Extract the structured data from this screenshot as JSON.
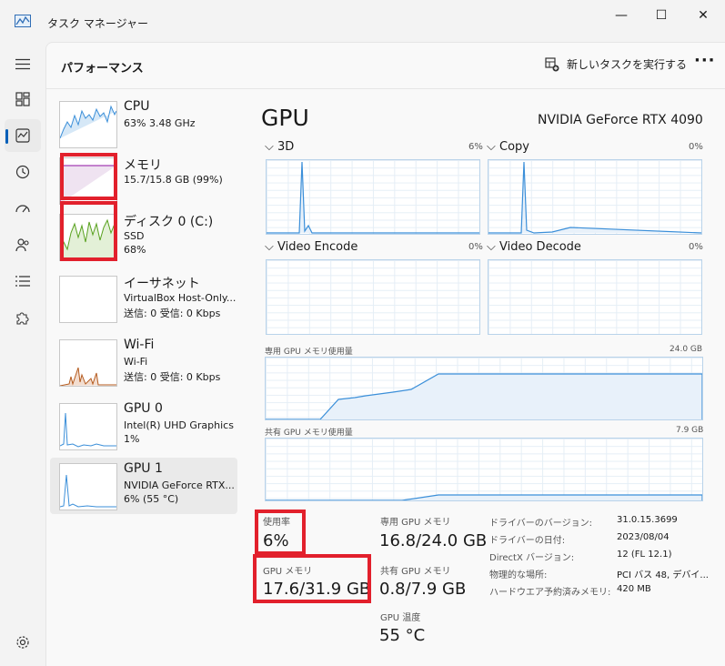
{
  "window": {
    "title": "タスク マネージャー",
    "minimize": "—",
    "maximize": "☐",
    "close": "✕"
  },
  "header": {
    "title": "パフォーマンス",
    "run_task": "新しいタスクを実行する",
    "more": "···"
  },
  "devices": [
    {
      "name": "CPU",
      "line1": "63% 3.48 GHz",
      "line2": ""
    },
    {
      "name": "メモリ",
      "line1": "15.7/15.8 GB (99%)",
      "line2": ""
    },
    {
      "name": "ディスク 0 (C:)",
      "line1": "SSD",
      "line2": "68%"
    },
    {
      "name": "イーサネット",
      "line1": "VirtualBox Host-Only...",
      "line2": "送信: 0 受信: 0 Kbps"
    },
    {
      "name": "Wi-Fi",
      "line1": "Wi-Fi",
      "line2": "送信: 0 受信: 0 Kbps"
    },
    {
      "name": "GPU 0",
      "line1": "Intel(R) UHD Graphics",
      "line2": "1%"
    },
    {
      "name": "GPU 1",
      "line1": "NVIDIA GeForce RTX...",
      "line2": "6% (55 °C)"
    }
  ],
  "gpu": {
    "title": "GPU",
    "model": "NVIDIA GeForce RTX 4090",
    "engines": [
      {
        "name": "3D",
        "pct": "6%"
      },
      {
        "name": "Copy",
        "pct": "0%"
      },
      {
        "name": "Video Encode",
        "pct": "0%"
      },
      {
        "name": "Video Decode",
        "pct": "0%"
      }
    ],
    "dedicated_mem_label": "専用 GPU メモリ使用量",
    "dedicated_mem_max": "24.0 GB",
    "shared_mem_label": "共有 GPU メモリ使用量",
    "shared_mem_max": "7.9 GB"
  },
  "stats": {
    "usage_label": "使用率",
    "usage_value": "6%",
    "gpu_mem_label": "GPU メモリ",
    "gpu_mem_value": "17.6/31.9 GB",
    "dedicated_label": "専用 GPU メモリ",
    "dedicated_value": "16.8/24.0 GB",
    "shared_label": "共有 GPU メモリ",
    "shared_value": "0.8/7.9 GB",
    "temp_label": "GPU 温度",
    "temp_value": "55 °C"
  },
  "info": [
    {
      "key": "ドライバーのバージョン:",
      "value": "31.0.15.3699"
    },
    {
      "key": "ドライバーの日付:",
      "value": "2023/08/04"
    },
    {
      "key": "DirectX バージョン:",
      "value": "12 (FL 12.1)"
    },
    {
      "key": "物理的な場所:",
      "value": "PCI バス 48, デバイ..."
    },
    {
      "key": "ハードウエア予約済みメモリ:",
      "value": "420 MB"
    }
  ],
  "colors": {
    "accent": "#005fb8",
    "highlight": "#e2202c",
    "gpu_line": "#3b8fd9",
    "memory_line": "#a43eb3",
    "disk_line": "#58a11e",
    "wifi_line": "#b45a1e"
  }
}
